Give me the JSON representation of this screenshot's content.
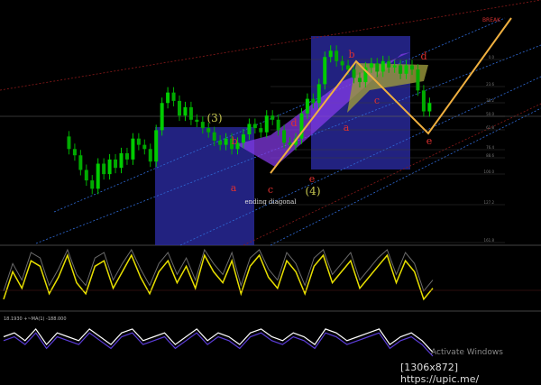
{
  "chart_data": [
    {
      "type": "line",
      "panel": "price",
      "x": [
        0,
        5,
        10,
        15,
        20,
        25,
        30,
        35,
        40,
        45,
        50,
        55,
        60,
        65,
        70,
        75,
        80,
        85,
        90,
        95,
        100,
        105,
        110,
        115,
        120,
        125,
        130,
        135,
        140,
        145,
        150,
        155,
        160,
        165,
        170,
        175,
        180,
        185,
        190,
        195,
        200,
        205,
        210,
        215,
        220,
        225,
        230,
        235,
        240,
        245,
        250,
        255,
        260,
        265,
        270,
        275,
        280,
        285,
        290,
        295,
        300,
        305,
        310,
        315,
        320,
        325,
        330,
        335,
        340,
        345,
        350,
        355,
        360,
        365,
        370,
        375,
        380,
        385,
        390,
        395,
        400,
        405
      ],
      "y": [
        0.52,
        0.46,
        0.43,
        0.36,
        0.31,
        0.27,
        0.39,
        0.34,
        0.41,
        0.37,
        0.44,
        0.41,
        0.51,
        0.48,
        0.46,
        0.4,
        0.55,
        0.68,
        0.73,
        0.69,
        0.62,
        0.66,
        0.6,
        0.59,
        0.56,
        0.54,
        0.5,
        0.48,
        0.51,
        0.46,
        0.49,
        0.53,
        0.58,
        0.56,
        0.54,
        0.62,
        0.6,
        0.55,
        0.49,
        0.48,
        0.51,
        0.63,
        0.7,
        0.68,
        0.77,
        0.9,
        0.93,
        0.88,
        0.86,
        0.84,
        0.8,
        0.78,
        0.85,
        0.87,
        0.83,
        0.88,
        0.85,
        0.86,
        0.82,
        0.86,
        0.84,
        0.74,
        0.64,
        0.68
      ],
      "waves": [
        {
          "label": "(3)",
          "role": "primary"
        },
        {
          "label": "(4)",
          "role": "primary"
        },
        {
          "label": "a",
          "role": "minor"
        },
        {
          "label": "b",
          "role": "minor"
        },
        {
          "label": "c",
          "role": "minor"
        },
        {
          "label": "d",
          "role": "minor"
        },
        {
          "label": "e",
          "role": "minor"
        },
        {
          "label": "a",
          "role": "minor"
        },
        {
          "label": "b",
          "role": "minor"
        },
        {
          "label": "c",
          "role": "minor"
        },
        {
          "label": "d",
          "role": "minor"
        },
        {
          "label": "e",
          "role": "minor"
        }
      ],
      "annotations": [
        "ending diagonal"
      ],
      "fib_levels": [
        "0.0",
        "23.6",
        "38.2",
        "50.0",
        "61.8",
        "76.4",
        "88.6",
        "100.0",
        "127.2",
        "161.8"
      ],
      "colors": {
        "up": "#00cc00",
        "down": "#00aa00",
        "box": "#2a2aa0",
        "wedge": "#8a3cf0",
        "triangle": "#9c9a3c",
        "projection": "#f0b040",
        "wave_label": "#e03030",
        "primary_label": "#c8c850"
      }
    },
    {
      "type": "line",
      "panel": "oscillator-1",
      "values": [
        0.1,
        0.6,
        0.3,
        0.8,
        0.7,
        0.2,
        0.5,
        0.9,
        0.4,
        0.2,
        0.7,
        0.8,
        0.3,
        0.6,
        0.9,
        0.5,
        0.2,
        0.6,
        0.8,
        0.4,
        0.7,
        0.3,
        0.9,
        0.6,
        0.4,
        0.8,
        0.2,
        0.7,
        0.9,
        0.5,
        0.3,
        0.8,
        0.6,
        0.2,
        0.7,
        0.9,
        0.4,
        0.6,
        0.8,
        0.3,
        0.5,
        0.7,
        0.9,
        0.4,
        0.8,
        0.6,
        0.1,
        0.3
      ],
      "colors": {
        "line": "#e8e000",
        "shadow": "#6c6c6c"
      }
    },
    {
      "type": "line",
      "panel": "oscillator-2",
      "label": "18.1930  +~MA(1) -188.000",
      "values": [
        0.5,
        0.6,
        0.4,
        0.7,
        0.3,
        0.6,
        0.5,
        0.4,
        0.7,
        0.5,
        0.3,
        0.6,
        0.7,
        0.4,
        0.5,
        0.6,
        0.3,
        0.5,
        0.7,
        0.4,
        0.6,
        0.5,
        0.3,
        0.6,
        0.7,
        0.5,
        0.4,
        0.6,
        0.5,
        0.3,
        0.7,
        0.6,
        0.4,
        0.5,
        0.6,
        0.7,
        0.3,
        0.5,
        0.6,
        0.4,
        0.1
      ],
      "colors": {
        "line": "#ffffff",
        "ma": "#5b3cd8"
      }
    }
  ],
  "watermark": {
    "activate": "Activate Windows",
    "credit": "[1306x872] https://upic.me/"
  },
  "top_right_tag": "BREAK"
}
